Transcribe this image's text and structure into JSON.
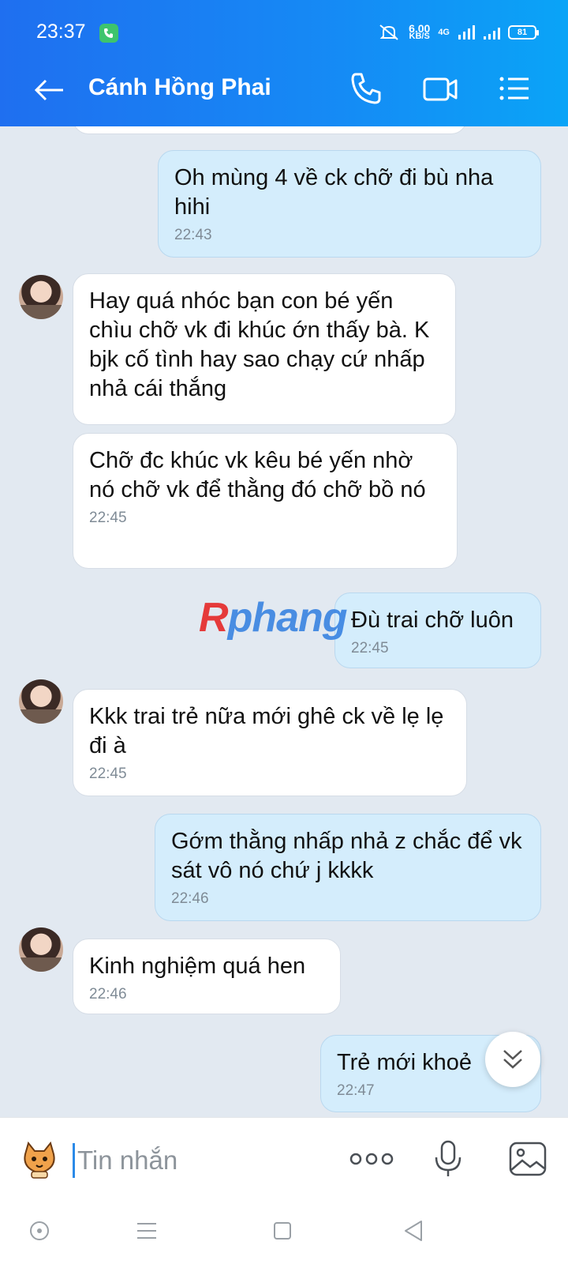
{
  "status": {
    "time": "23:37",
    "net_speed": "6.00",
    "net_unit": "KB/S",
    "network": "4G",
    "battery": "81"
  },
  "header": {
    "title": "Cánh Hồng Phai"
  },
  "messages": [
    {
      "dir": "out",
      "text": "Oh mùng 4 về ck chỡ đi bù nha hihi",
      "time": "22:43"
    },
    {
      "dir": "in",
      "text": "Hay quá nhóc bạn con bé yến chìu chỡ vk đi khúc ớn thấy bà. K bjk cố tình hay sao chạy cứ nhấp nhả cái thắng",
      "time": ""
    },
    {
      "dir": "in",
      "text": "Chỡ đc khúc vk kêu bé yến nhờ nó chỡ vk để thằng đó chỡ bồ nó",
      "time": "22:45"
    },
    {
      "dir": "out",
      "text": "Đù trai chỡ luôn",
      "time": "22:45"
    },
    {
      "dir": "in",
      "text": "Kkk trai trẻ nữa mới ghê ck về lẹ lẹ đi à",
      "time": "22:45"
    },
    {
      "dir": "out",
      "text": "Gớm thằng nhấp nhả z chắc để vk sát vô nó chứ j kkkk",
      "time": "22:46"
    },
    {
      "dir": "in",
      "text": "Kinh nghiệm quá hen",
      "time": "22:46"
    },
    {
      "dir": "out",
      "text": "Trẻ mới khoẻ",
      "time": "22:47"
    }
  ],
  "watermark": {
    "r": "R",
    "rest": "phang"
  },
  "composer": {
    "placeholder": "Tin nhắn"
  },
  "colors": {
    "header": "#158bf5",
    "chat_bg": "#e2e9f1",
    "out_bubble": "#d4edfc",
    "in_bubble": "#ffffff"
  }
}
